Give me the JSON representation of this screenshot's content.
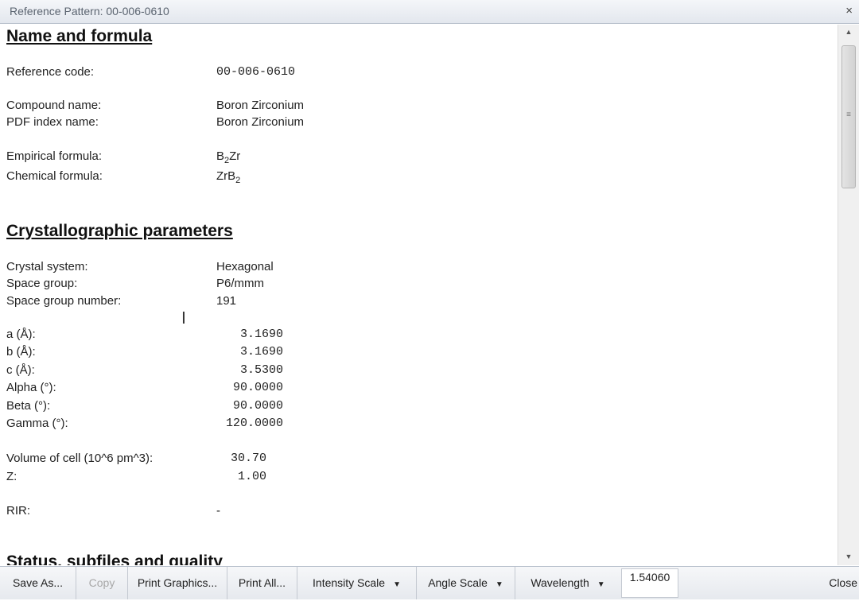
{
  "window": {
    "title": "Reference Pattern: 00-006-0610",
    "close_glyph": "×"
  },
  "sections": {
    "name_formula": "Name and formula",
    "crystallographic": "Crystallographic parameters",
    "status": "Status, subfiles and quality"
  },
  "name_formula": {
    "ref_code_label": "Reference code:",
    "ref_code_value": "00-006-0610",
    "compound_label": "Compound name:",
    "compound_value": "Boron Zirconium",
    "pdf_index_label": "PDF index name:",
    "pdf_index_value": "Boron Zirconium",
    "empirical_label": "Empirical formula:",
    "empirical_a": "B",
    "empirical_sub": "2",
    "empirical_b": "Zr",
    "chemical_label": "Chemical formula:",
    "chemical_a": "ZrB",
    "chemical_sub": "2"
  },
  "crystal": {
    "system_label": "Crystal system:",
    "system_value": "Hexagonal",
    "space_group_label": "Space group:",
    "space_group_value": "P6/mmm",
    "space_group_num_label": "Space group number:",
    "space_group_num_value": "191",
    "a_label": "a (Å):",
    "a_value": "3.1690",
    "b_label": "b (Å):",
    "b_value": "3.1690",
    "c_label": "c (Å):",
    "c_value": "3.5300",
    "alpha_label": "Alpha (°):",
    "alpha_value": "90.0000",
    "beta_label": "Beta (°):",
    "beta_value": "90.0000",
    "gamma_label": "Gamma (°):",
    "gamma_value": "120.0000",
    "volume_label": "Volume of cell (10^6 pm^3):",
    "volume_value": "30.70",
    "z_label": "Z:",
    "z_value": "1.00",
    "rir_label": "RIR:",
    "rir_value": "-"
  },
  "toolbar": {
    "save_as": "Save As...",
    "copy": "Copy",
    "print_graphics": "Print Graphics...",
    "print_all": "Print All...",
    "intensity_scale": "Intensity Scale",
    "angle_scale": "Angle Scale",
    "wavelength": "Wavelength",
    "wavelength_value": "1.54060",
    "close": "Close"
  }
}
